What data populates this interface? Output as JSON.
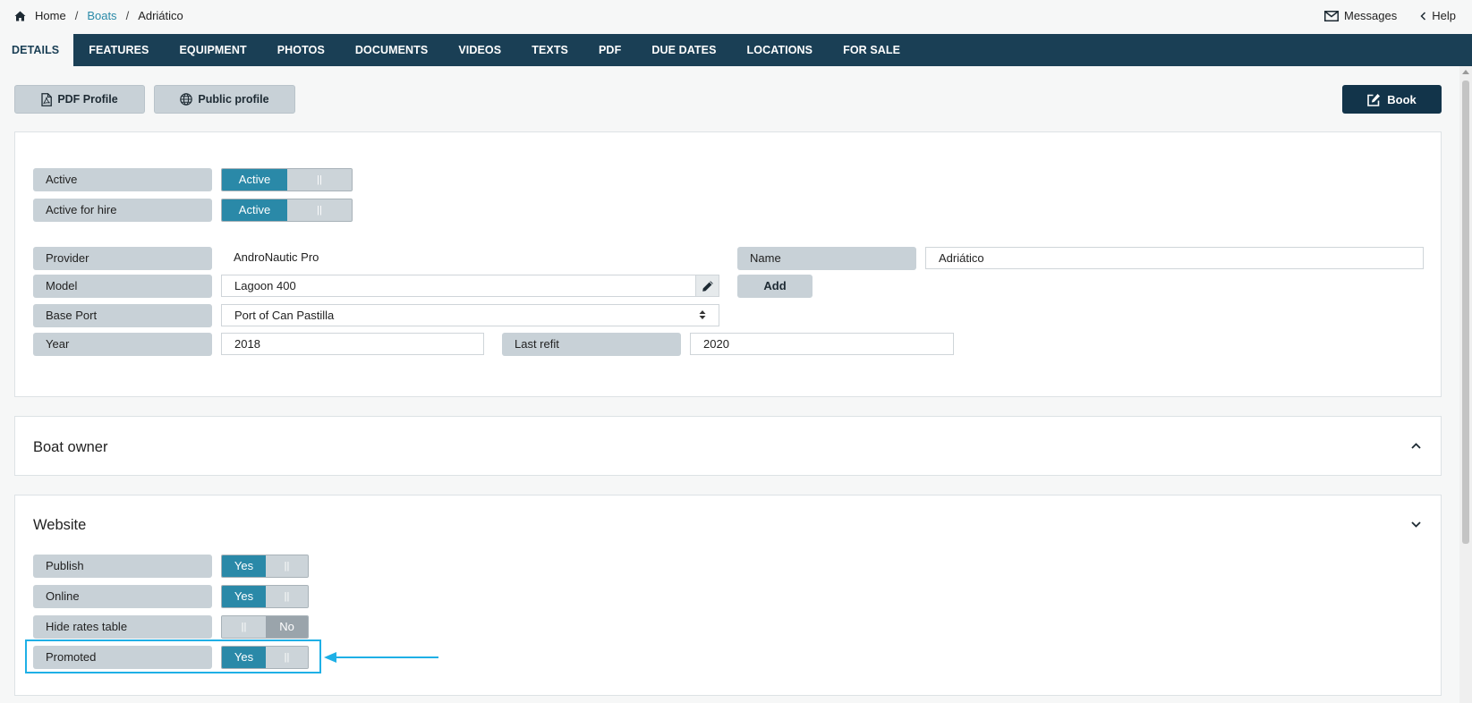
{
  "breadcrumb": {
    "home": "Home",
    "section": "Boats",
    "current": "Adriático"
  },
  "topbar": {
    "messages": "Messages",
    "help": "Help"
  },
  "tabs": [
    "DETAILS",
    "FEATURES",
    "EQUIPMENT",
    "PHOTOS",
    "DOCUMENTS",
    "VIDEOS",
    "TEXTS",
    "PDF",
    "DUE DATES",
    "LOCATIONS",
    "FOR SALE"
  ],
  "actions": {
    "pdf_profile": "PDF Profile",
    "public_profile": "Public profile",
    "book": "Book"
  },
  "details": {
    "active_label": "Active",
    "active_value": "Active",
    "active_hire_label": "Active for hire",
    "active_hire_value": "Active",
    "provider_label": "Provider",
    "provider_value": "AndroNautic Pro",
    "name_label": "Name",
    "name_value": "Adriático",
    "model_label": "Model",
    "model_value": "Lagoon 400",
    "add_button": "Add",
    "base_port_label": "Base Port",
    "base_port_value": "Port of Can Pastilla",
    "year_label": "Year",
    "year_value": "2018",
    "last_refit_label": "Last refit",
    "last_refit_value": "2020"
  },
  "owner_card": {
    "title": "Boat owner"
  },
  "website_card": {
    "title": "Website",
    "publish_label": "Publish",
    "publish_value": "Yes",
    "online_label": "Online",
    "online_value": "Yes",
    "hide_rates_label": "Hide rates table",
    "hide_rates_value": "No",
    "promoted_label": "Promoted",
    "promoted_value": "Yes"
  },
  "toggle_handle": "||",
  "colors": {
    "nav": "#1a3f55",
    "accent": "#2a89a8",
    "highlight": "#1fb0e6",
    "book": "#12344a"
  }
}
